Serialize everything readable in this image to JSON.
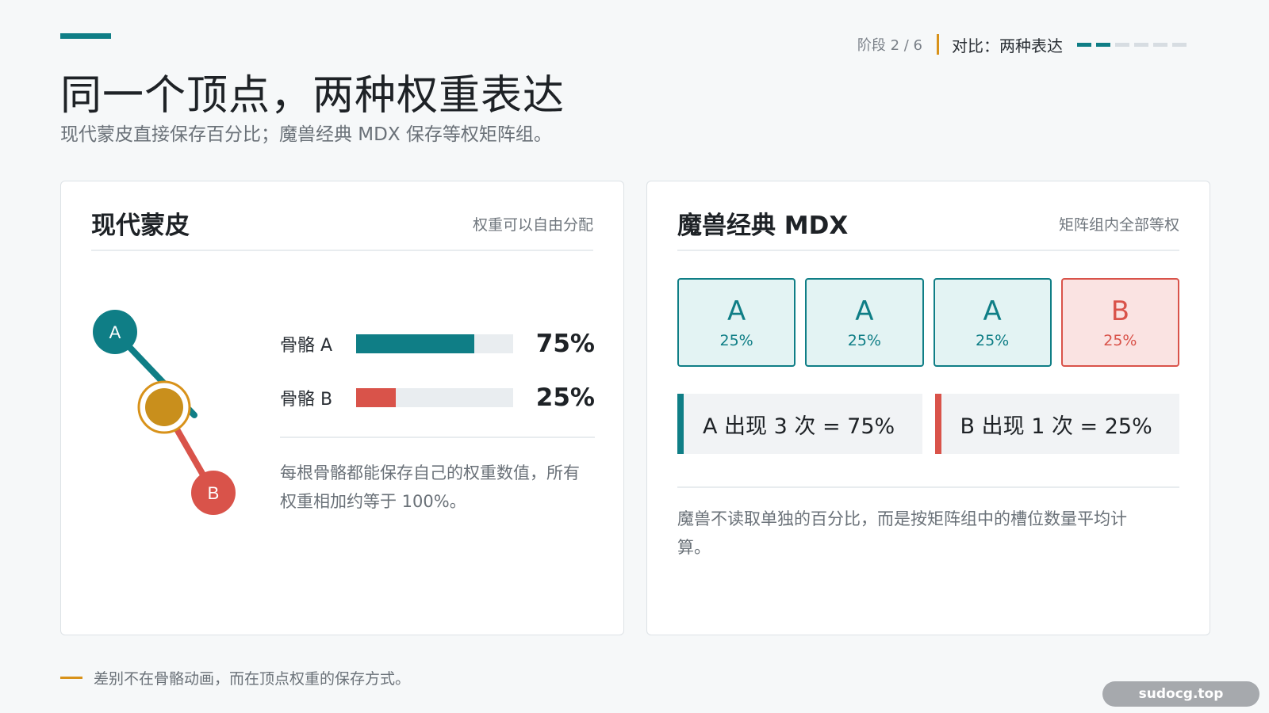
{
  "header": {
    "title": "同一个顶点，两种权重表达",
    "subtitle": "现代蒙皮直接保存百分比；魔兽经典 MDX 保存等权矩阵组。",
    "stage": "阶段 2 / 6",
    "stage_name": "对比：两种表达",
    "progress": {
      "current": 2,
      "total": 6
    }
  },
  "colors": {
    "teal": "#0f7e86",
    "red": "#d9534a",
    "gold": "#d8921a"
  },
  "modern": {
    "title": "现代蒙皮",
    "tag": "权重可以自由分配",
    "bone_a_marker": "A",
    "bone_b_marker": "B",
    "bones": [
      {
        "label": "骨骼 A",
        "value": "75%",
        "fraction": 0.75
      },
      {
        "label": "骨骼 B",
        "value": "25%",
        "fraction": 0.25
      }
    ],
    "note": "每根骨骼都能保存自己的权重数值，所有权重相加约等于 100%。"
  },
  "mdx": {
    "title": "魔兽经典 MDX",
    "tag": "矩阵组内全部等权",
    "slots": [
      {
        "letter": "A",
        "pct": "25%"
      },
      {
        "letter": "A",
        "pct": "25%"
      },
      {
        "letter": "A",
        "pct": "25%"
      },
      {
        "letter": "B",
        "pct": "25%"
      }
    ],
    "count_a": "A 出现 3 次 = 75%",
    "count_b": "B 出现 1 次 = 25%",
    "note": "魔兽不读取单独的百分比，而是按矩阵组中的槽位数量平均计算。"
  },
  "footer": {
    "text": "差别不在骨骼动画，而在顶点权重的保存方式。"
  },
  "watermark": "sudocg.top"
}
